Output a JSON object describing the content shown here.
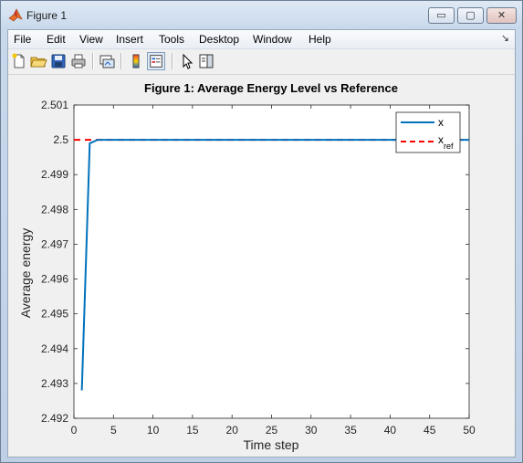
{
  "window": {
    "title": "Figure 1",
    "min_glyph": "▭",
    "max_glyph": "▢",
    "close_glyph": "✕"
  },
  "menu": {
    "items": [
      "File",
      "Edit",
      "View",
      "Insert",
      "Tools",
      "Desktop",
      "Window",
      "Help"
    ],
    "overflow_glyph": "↘"
  },
  "toolbar": {
    "icons": [
      "new-figure-icon",
      "open-file-icon",
      "save-icon",
      "print-icon",
      "link-plot-icon",
      "colorbar-icon",
      "legend-icon",
      "pointer-icon",
      "property-editor-icon"
    ]
  },
  "colors": {
    "series_x": "#0072bd",
    "series_ref": "#ff0000"
  },
  "chart_data": {
    "type": "line",
    "title": "Figure 1: Average Energy Level vs Reference",
    "xlabel": "Time step",
    "ylabel": "Average energy",
    "xlim": [
      0,
      50
    ],
    "ylim": [
      2.492,
      2.501
    ],
    "xticks": [
      "0",
      "5",
      "10",
      "15",
      "20",
      "25",
      "30",
      "35",
      "40",
      "45",
      "50"
    ],
    "yticks": [
      "2.492",
      "2.493",
      "2.494",
      "2.495",
      "2.496",
      "2.497",
      "2.498",
      "2.499",
      "2.5",
      "2.501"
    ],
    "xtick_values": [
      0,
      5,
      10,
      15,
      20,
      25,
      30,
      35,
      40,
      45,
      50
    ],
    "ytick_values": [
      2.492,
      2.493,
      2.494,
      2.495,
      2.496,
      2.497,
      2.498,
      2.499,
      2.5,
      2.501
    ],
    "grid": false,
    "legend_position": "top-right",
    "series": [
      {
        "name": "x",
        "style": "solid",
        "x": [
          1,
          2,
          3,
          4,
          5,
          10,
          15,
          20,
          25,
          30,
          35,
          40,
          45,
          50
        ],
        "y": [
          2.4928,
          2.4999,
          2.5,
          2.5,
          2.5,
          2.5,
          2.5,
          2.5,
          2.5,
          2.5,
          2.5,
          2.5,
          2.5,
          2.5
        ]
      },
      {
        "name": "x_ref",
        "legend_main": "x",
        "legend_sub": "ref",
        "style": "dashed",
        "x": [
          0,
          50
        ],
        "y": [
          2.5,
          2.5
        ]
      }
    ]
  }
}
